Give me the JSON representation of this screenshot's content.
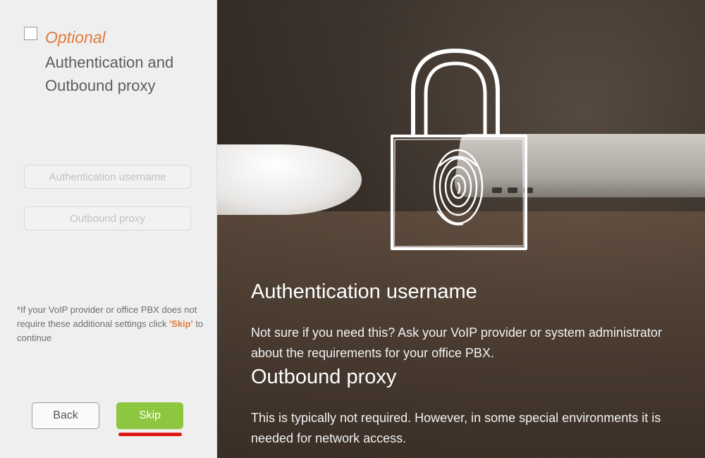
{
  "wizard": {
    "optional_label": "Optional",
    "section_title": "Authentication and Outbound proxy",
    "fields": {
      "auth_username_placeholder": "Authentication username",
      "outbound_proxy_placeholder": "Outbound proxy"
    },
    "note": {
      "prefix": "*If your VoIP provider or office PBX does not require these additional settings click ",
      "skip_word": "'Skip'",
      "suffix": " to continue"
    },
    "buttons": {
      "back_label": "Back",
      "skip_label": "Skip"
    }
  },
  "hero": {
    "auth_heading": "Authentication username",
    "auth_text": "Not sure if you need this? Ask your VoIP provider or system administrator about the requirements for your office PBX.",
    "proxy_heading": "Outbound proxy",
    "proxy_text": "This is typically not required. However, in some special environments it is needed for network access."
  },
  "colors": {
    "accent_orange": "#e07b39",
    "skip_green": "#8dc63f",
    "annotation_red": "#e01818"
  },
  "icons": {
    "lock": "fingerprint-lock-icon",
    "checkbox": "checkbox-icon"
  }
}
